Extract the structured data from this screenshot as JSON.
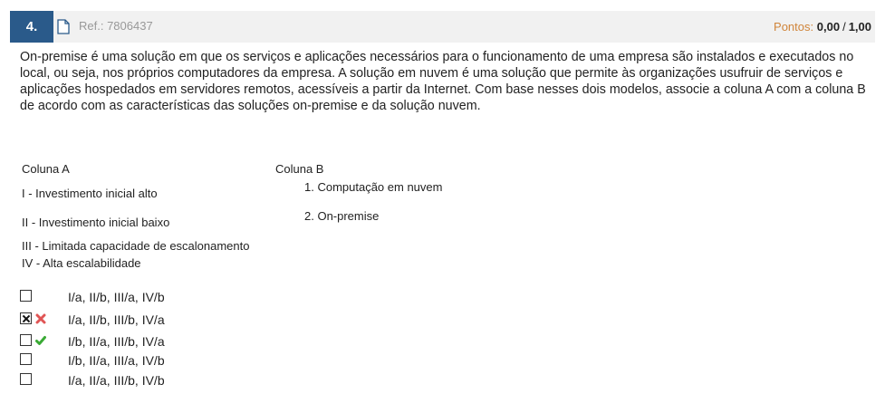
{
  "header": {
    "question_number": "4.",
    "ref_label": "Ref.: 7806437",
    "points_label": "Pontos:",
    "points_value": "0,00",
    "points_separator": "/",
    "points_max": "1,00"
  },
  "question": {
    "text": "On-premise é uma solução em que os serviços e aplicações necessários para o funcionamento de uma empresa são instalados e executados no local, ou seja, nos próprios computadores da empresa. A solução em nuvem é uma solução que permite às organizações usufruir de serviços e aplicações hospedados em servidores remotos, acessíveis a partir da Internet. Com base nesses dois modelos, associe a coluna A com a coluna B de acordo com as características das soluções on-premise e da solução nuvem."
  },
  "columns": {
    "a_title": "Coluna A",
    "b_title": "Coluna B",
    "a_items": [
      "I - Investimento inicial alto",
      "II - Investimento inicial baixo",
      "III - Limitada capacidade de escalonamento",
      "IV - Alta escalabilidade"
    ],
    "b_items": [
      "1. Computação em nuvem",
      "2. On-premise"
    ]
  },
  "options": [
    {
      "label": "I/a, II/b, III/a, IV/b",
      "checked": false,
      "mark": ""
    },
    {
      "label": "I/a, II/b, III/b, IV/a",
      "checked": true,
      "mark": "wrong"
    },
    {
      "label": "I/b, II/a, III/b, IV/a",
      "checked": false,
      "mark": "correct"
    },
    {
      "label": "I/b, II/a, III/a, IV/b",
      "checked": false,
      "mark": ""
    },
    {
      "label": "I/a, II/a, III/b, IV/b",
      "checked": false,
      "mark": ""
    }
  ],
  "colors": {
    "badge": "#2a5a8a",
    "points_label": "#d0853a",
    "wrong": "#e05555",
    "correct": "#3aaa35"
  }
}
